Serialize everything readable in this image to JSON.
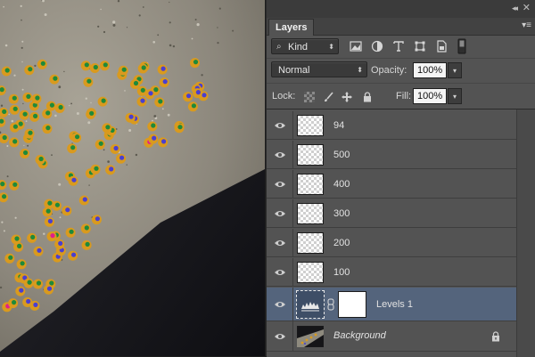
{
  "panel": {
    "tab_label": "Layers",
    "collapse_glyph": "◂◂",
    "close_glyph": "✕",
    "menu_glyph": "▾≡"
  },
  "filter": {
    "kind_value": "Kind",
    "kind_arrow": "⬍",
    "icons": [
      "pixel-filter-icon",
      "adjustment-filter-icon",
      "type-filter-icon",
      "shape-filter-icon",
      "smart-object-filter-icon",
      "filter-toggle-icon"
    ]
  },
  "blend": {
    "mode_value": "Normal",
    "mode_arrow": "⬍",
    "opacity_label": "Opacity:",
    "opacity_value": "100%",
    "opacity_arrow": "▾"
  },
  "lock": {
    "label": "Lock:",
    "icons": [
      "lock-transparency-icon",
      "lock-pixels-icon",
      "lock-position-icon",
      "lock-all-icon"
    ],
    "fill_label": "Fill:",
    "fill_value": "100%",
    "fill_arrow": "▾"
  },
  "layers": [
    {
      "name": "94",
      "visible": true,
      "type": "pixel"
    },
    {
      "name": "500",
      "visible": true,
      "type": "pixel"
    },
    {
      "name": "400",
      "visible": true,
      "type": "pixel"
    },
    {
      "name": "300",
      "visible": true,
      "type": "pixel"
    },
    {
      "name": "200",
      "visible": true,
      "type": "pixel"
    },
    {
      "name": "100",
      "visible": true,
      "type": "pixel"
    },
    {
      "name": "Levels 1",
      "visible": true,
      "type": "adjustment",
      "selected": true
    },
    {
      "name": "Background",
      "visible": true,
      "type": "background",
      "locked": true
    }
  ],
  "colors": {
    "panel_bg": "#535353",
    "selected_row": "#54647c",
    "marker_orange": "#d99a1e",
    "marker_green": "#1e8a3a",
    "marker_blue": "#4a3fd0",
    "marker_magenta": "#e0208a"
  }
}
